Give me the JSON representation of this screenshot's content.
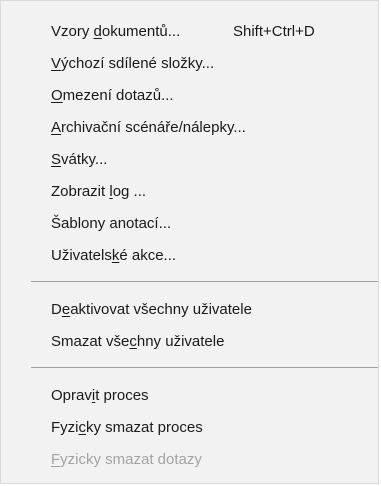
{
  "menu": {
    "items": [
      {
        "label": "Vzory dokumentů...",
        "shortcut": "Shift+Ctrl+D",
        "mnemonic": 6,
        "enabled": true
      },
      {
        "label": "Výchozí sdílené složky...",
        "shortcut": "",
        "mnemonic": 0,
        "enabled": true
      },
      {
        "label": "Omezení dotazů...",
        "shortcut": "",
        "mnemonic": 0,
        "enabled": true
      },
      {
        "label": "Archivační scénáře/nálepky...",
        "shortcut": "",
        "mnemonic": 0,
        "enabled": true
      },
      {
        "label": "Svátky...",
        "shortcut": "",
        "mnemonic": 0,
        "enabled": true
      },
      {
        "label": "Zobrazit log ...",
        "shortcut": "",
        "mnemonic": 9,
        "enabled": true
      },
      {
        "label": "Šablony anotací...",
        "shortcut": "",
        "mnemonic": -1,
        "enabled": true
      },
      {
        "label": "Uživatelské akce...",
        "shortcut": "",
        "mnemonic": 9,
        "enabled": true
      },
      {
        "label": "Deaktivovat všechny uživatele",
        "shortcut": "",
        "mnemonic": 1,
        "enabled": true
      },
      {
        "label": "Smazat všechny uživatele",
        "shortcut": "",
        "mnemonic": 10,
        "enabled": true
      },
      {
        "label": "Opravit proces",
        "shortcut": "",
        "mnemonic": 5,
        "enabled": true
      },
      {
        "label": "Fyzicky smazat proces",
        "shortcut": "",
        "mnemonic": 4,
        "enabled": true
      },
      {
        "label": "Fyzicky smazat dotazy",
        "shortcut": "",
        "mnemonic": 0,
        "enabled": false
      }
    ]
  }
}
